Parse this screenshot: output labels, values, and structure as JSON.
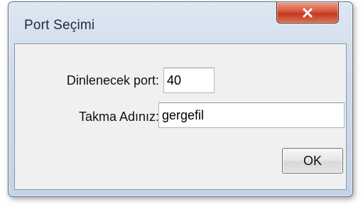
{
  "window": {
    "title": "Port Seçimi"
  },
  "titlebar": {
    "close_icon": "close-icon"
  },
  "form": {
    "port_label": "Dinlenecek port:",
    "port_value": "40",
    "nickname_label": "Takma Adınız:",
    "nickname_value": "gergefil",
    "ok_label": "OK"
  },
  "colors": {
    "close_button": "#c9452a",
    "client_background": "#f0f0f0",
    "frame": "#cfdbea"
  }
}
